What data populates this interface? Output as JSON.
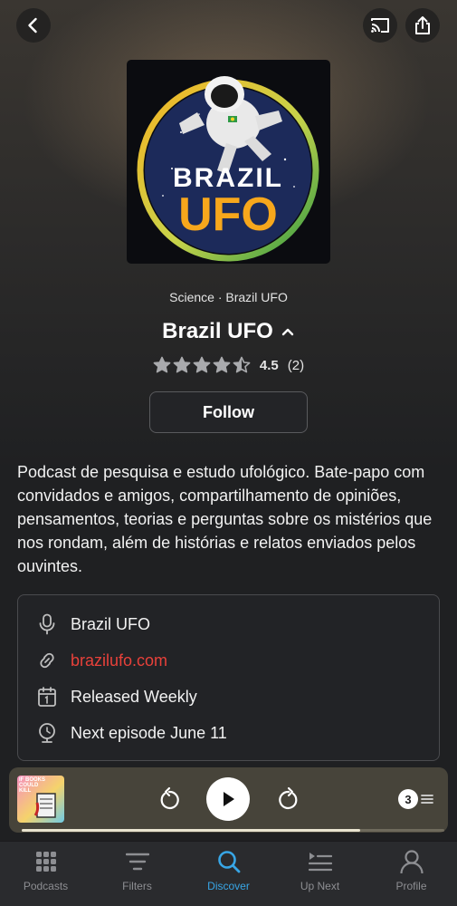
{
  "header": {
    "back_icon": "chevron-left-icon",
    "cast_icon": "cast-icon",
    "share_icon": "share-icon"
  },
  "artwork": {
    "line1": "BRAZIL",
    "line2": "UFO",
    "accent": "#f7a71c"
  },
  "podcast": {
    "category": "Science · Brazil UFO",
    "title": "Brazil UFO",
    "rating_value": "4.5",
    "rating_count": "(2)",
    "rating_stars": 4.5,
    "follow_label": "Follow",
    "description": "Podcast de pesquisa e estudo ufológico. Bate-papo com convidados e amigos, compartilhamento de opiniões, pensamentos, teorias e perguntas sobre os mistérios que nos rondam, além de histórias e relatos enviados pelos ouvintes."
  },
  "info": {
    "author": "Brazil UFO",
    "website": "brazilufo.com",
    "schedule": "Released Weekly",
    "next_episode": "Next episode June 11",
    "link_color": "#e8413a"
  },
  "mini_player": {
    "art_text": "IF BOOKS COULD KILL",
    "queue_count": "3",
    "progress": 0.8
  },
  "tabs": [
    {
      "label": "Podcasts",
      "icon": "grid-icon",
      "active": false
    },
    {
      "label": "Filters",
      "icon": "filter-icon",
      "active": false
    },
    {
      "label": "Discover",
      "icon": "search-icon",
      "active": true
    },
    {
      "label": "Up Next",
      "icon": "up-next-icon",
      "active": false
    },
    {
      "label": "Profile",
      "icon": "person-icon",
      "active": false
    }
  ],
  "colors": {
    "active_tab": "#38a6e6",
    "background": "#1f2022"
  }
}
